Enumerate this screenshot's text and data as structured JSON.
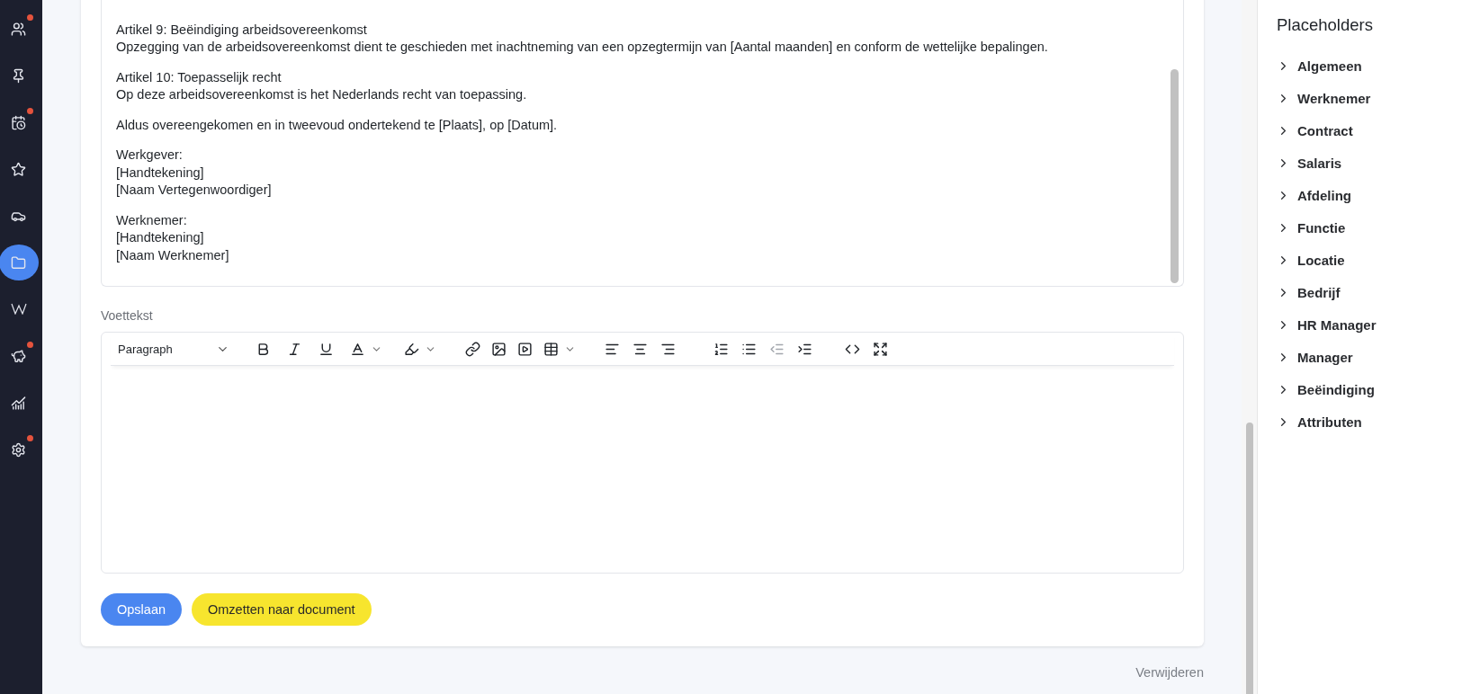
{
  "nav": {
    "items": [
      {
        "selected": false,
        "notification": true
      },
      {
        "selected": false,
        "notification": false
      },
      {
        "selected": false,
        "notification": true
      },
      {
        "selected": false,
        "notification": false
      },
      {
        "selected": false,
        "notification": false
      },
      {
        "selected": true,
        "notification": false
      },
      {
        "selected": false,
        "notification": false
      },
      {
        "selected": false,
        "notification": true
      },
      {
        "selected": false,
        "notification": false
      },
      {
        "selected": false,
        "notification": true
      }
    ]
  },
  "body_editor": {
    "paragraphs": [
      {
        "lines": [
          "Artikel 9: Beëindiging arbeidsovereenkomst",
          "Opzegging van de arbeidsovereenkomst dient te geschieden met inachtneming van een opzegtermijn van [Aantal maanden] en conform de wettelijke bepalingen."
        ]
      },
      {
        "lines": [
          "Artikel 10: Toepasselijk recht",
          "Op deze arbeidsovereenkomst is het Nederlands recht van toepassing."
        ]
      },
      {
        "lines": [
          "Aldus overeengekomen en in tweevoud ondertekend te [Plaats], op [Datum]."
        ]
      },
      {
        "lines": [
          "Werkgever:",
          "[Handtekening]",
          "[Naam Vertegenwoordiger]"
        ]
      },
      {
        "lines": [
          "Werknemer:",
          "[Handtekening]",
          "[Naam Werknemer]"
        ]
      }
    ]
  },
  "footer_editor": {
    "label": "Voettekst",
    "block_format": "Paragraph",
    "tools": [
      {
        "disabled": false
      },
      {
        "disabled": false
      },
      {
        "disabled": false
      },
      {
        "disabled": false
      },
      {
        "disabled": false
      },
      {
        "disabled": false
      },
      {
        "disabled": false
      },
      {
        "disabled": false
      },
      {
        "disabled": false
      },
      {
        "disabled": false
      },
      {
        "disabled": false
      },
      {
        "disabled": false
      },
      {
        "disabled": false
      },
      {
        "disabled": false
      },
      {
        "disabled": true
      },
      {
        "disabled": false
      },
      {
        "disabled": false
      },
      {
        "disabled": false
      }
    ]
  },
  "buttons": [
    {
      "label": "Opslaan",
      "kind": "primary"
    },
    {
      "label": "Omzetten naar document",
      "kind": "accent"
    }
  ],
  "delete_link": "Verwijderen",
  "placeholders": {
    "title": "Placeholders",
    "items": [
      {
        "label": "Algemeen",
        "expanded": false
      },
      {
        "label": "Werknemer",
        "expanded": false
      },
      {
        "label": "Contract",
        "expanded": false
      },
      {
        "label": "Salaris",
        "expanded": false
      },
      {
        "label": "Afdeling",
        "expanded": false
      },
      {
        "label": "Functie",
        "expanded": false
      },
      {
        "label": "Locatie",
        "expanded": false
      },
      {
        "label": "Bedrijf",
        "expanded": false
      },
      {
        "label": "HR Manager",
        "expanded": false
      },
      {
        "label": "Manager",
        "expanded": false
      },
      {
        "label": "Beëindiging",
        "expanded": false
      },
      {
        "label": "Attributen",
        "expanded": false
      }
    ]
  }
}
